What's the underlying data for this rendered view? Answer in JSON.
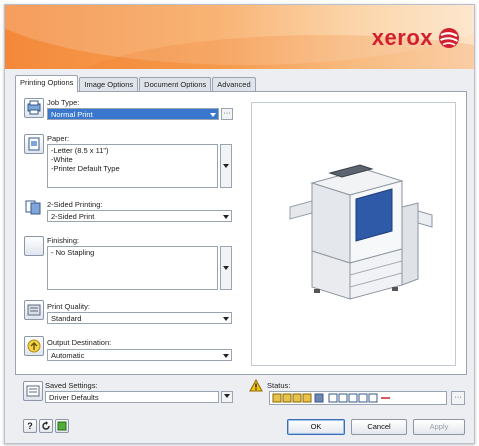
{
  "brand": {
    "logo_text": "xerox",
    "logo_colors": {
      "text": "#d3202f",
      "ball": "#d3202f"
    }
  },
  "tabs": [
    {
      "label": "Printing Options",
      "active": true
    },
    {
      "label": "Image Options",
      "active": false
    },
    {
      "label": "Document Options",
      "active": false
    },
    {
      "label": "Advanced",
      "active": false
    }
  ],
  "job_type": {
    "label": "Job Type:",
    "value": "Normal Print",
    "icon": "job-type-icon"
  },
  "paper": {
    "label": "Paper:",
    "lines": [
      "-Letter (8.5 x 11\")",
      "-White",
      "-Printer Default Type"
    ],
    "icon": "paper-icon"
  },
  "two_sided": {
    "label": "2-Sided Printing:",
    "value": "2-Sided Print",
    "icon": "two-sided-icon"
  },
  "finishing": {
    "label": "Finishing:",
    "lines": [
      "- No Stapling"
    ],
    "icon": "finishing-icon"
  },
  "print_quality": {
    "label": "Print Quality:",
    "value": "Standard",
    "icon": "print-quality-icon"
  },
  "output_destination": {
    "label": "Output Destination:",
    "value": "Automatic",
    "icon": "output-destination-icon"
  },
  "saved_settings": {
    "label": "Saved Settings:",
    "value": "Driver Defaults"
  },
  "status": {
    "label": "Status:"
  },
  "buttons": {
    "help": "?",
    "ok": "OK",
    "cancel": "Cancel",
    "apply": "Apply"
  },
  "colors": {
    "accent_selection": "#3a78d0",
    "banner_orange": "#f4883a",
    "printer_blue": "#2f5aa8"
  }
}
